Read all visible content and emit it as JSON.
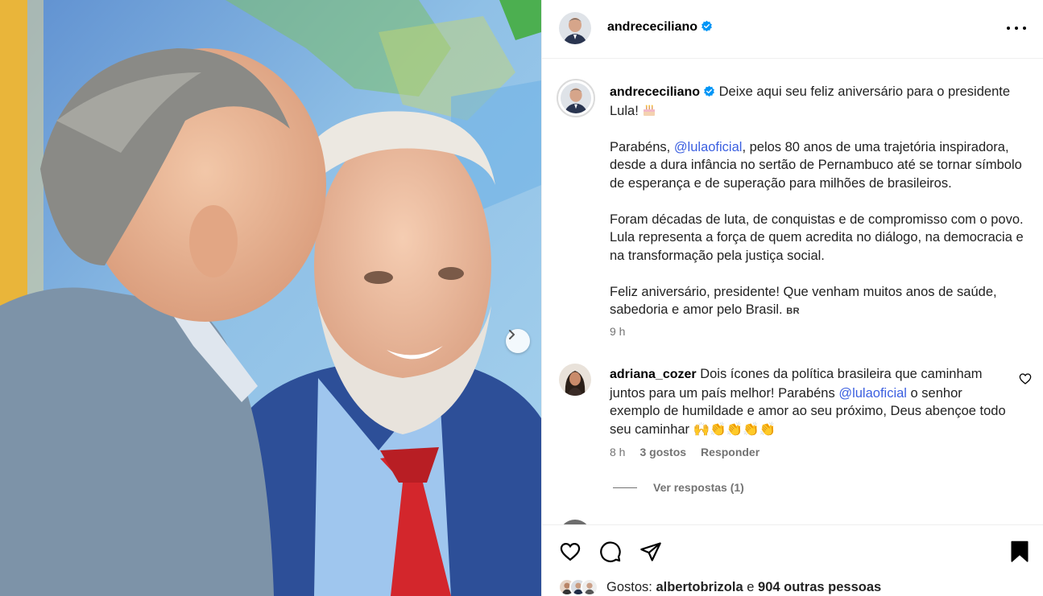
{
  "post": {
    "author": "andrececiliano",
    "verified": true
  },
  "caption": {
    "username": "andrececiliano",
    "intro": "Deixe aqui seu feliz aniversário para o presidente Lula!",
    "para2_before": "Parabéns, ",
    "para2_mention": "@lulaoficial",
    "para2_after": ", pelos 80 anos de uma trajetória inspiradora, desde a dura infância no sertão de Pernambuco até se tornar símbolo de esperança e de superação para milhões de brasileiros.",
    "para3": "Foram décadas de luta, de conquistas e de compromisso com o povo. Lula representa a força de quem acredita no diálogo, na democracia e na transformação pela justiça social.",
    "para4": "Feliz aniversário, presidente! Que venham muitos anos de saúde, sabedoria e amor pelo Brasil.",
    "flag": "BR",
    "time": "9 h"
  },
  "comments": [
    {
      "username": "adriana_cozer",
      "text_before": "Dois ícones da política brasileira que caminham juntos para um país melhor! Parabéns ",
      "mention": "@lulaoficial",
      "text_after": " o senhor exemplo de humildade e amor ao seu próximo, Deus abençoe todo seu caminhar ",
      "emojis": "🙌👏👏👏👏",
      "time": "8 h",
      "likes": "3 gostos",
      "reply_label": "Responder",
      "view_replies": "Ver respostas (1)"
    }
  ],
  "likes": {
    "label": "Gostos:",
    "first_user": "albertobrizola",
    "connector": "e",
    "others": "904 outras pessoas"
  },
  "colors": {
    "mention": "#3b5fe0",
    "verified": "#0095f6",
    "muted": "#737373"
  }
}
